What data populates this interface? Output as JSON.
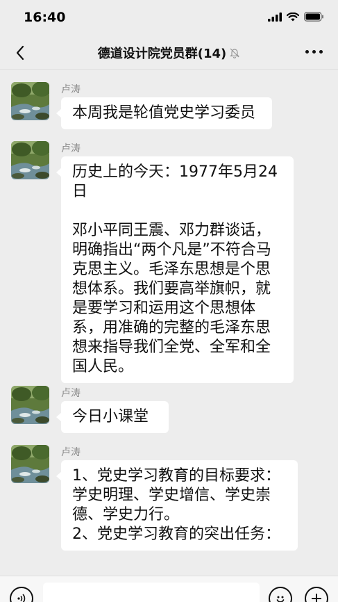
{
  "status_bar": {
    "time": "16:40"
  },
  "nav": {
    "title": "德道设计院党员群(14)"
  },
  "messages": [
    {
      "sender": "卢涛",
      "text": "本周我是轮值党史学习委员"
    },
    {
      "sender": "卢涛",
      "text": "历史上的今天：1977年5月24日\n\n邓小平同王震、邓力群谈话，明确指出“两个凡是”不符合马克思主义。毛泽东思想是个思想体系。我们要高举旗帜，就是要学习和运用这个思想体系，用准确的完整的毛泽东思想来指导我们全党、全军和全国人民。"
    },
    {
      "sender": "卢涛",
      "text": "今日小课堂"
    },
    {
      "sender": "卢涛",
      "text": "1、党史学习教育的目标要求：\n学史明理、学史增信、学史崇德、学史力行。\n2、党史学习教育的突出任务："
    }
  ],
  "icons": {
    "back": "chevron-left-icon",
    "mute": "bell-mute-icon",
    "more": "more-dots-icon",
    "voice": "voice-icon",
    "emoji": "emoji-icon",
    "plus": "plus-icon"
  },
  "colors": {
    "background": "#ededed",
    "bubble": "#ffffff",
    "sender": "#8a8a8a"
  }
}
